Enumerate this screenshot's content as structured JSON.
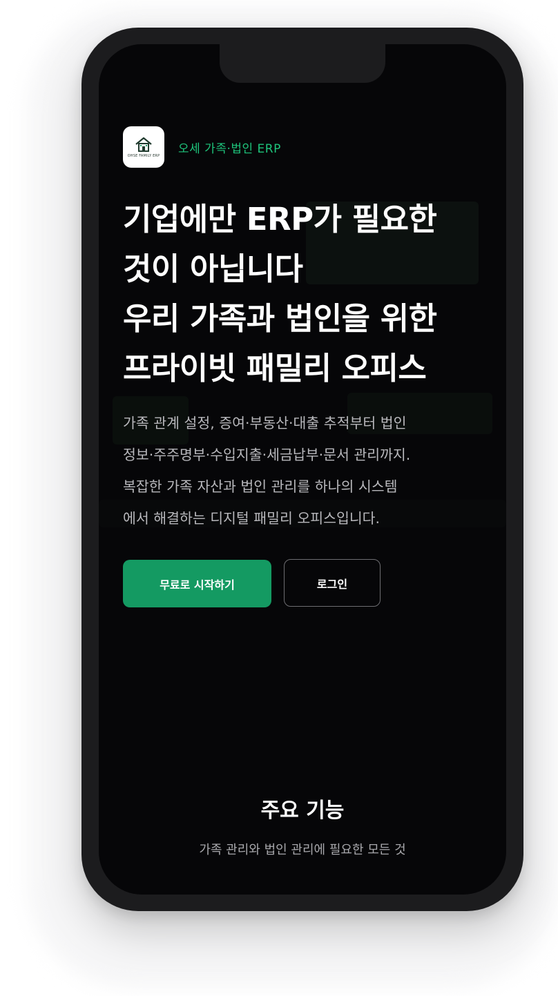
{
  "brand": {
    "name": "오세 가족·법인 ERP",
    "logo_caption": "OHSE FAMILY ERP",
    "accent_color": "#1ec47c"
  },
  "hero": {
    "headline_lines": [
      "기업에만 ERP가 필요한",
      "것이 아닙니다",
      "우리 가족과 법인을 위한",
      "프라이빗 패밀리 오피스"
    ],
    "description_lines": [
      "가족 관계 설정, 증여·부동산·대출 추적부터 법인",
      "정보·주주명부·수입지출·세금납부·문서 관리까지.",
      "복잡한 가족 자산과 법인 관리를 하나의 시스템",
      "에서 해결하는 디지털 패밀리 오피스입니다."
    ]
  },
  "actions": {
    "primary_label": "무료로 시작하기",
    "primary_color": "#149a62",
    "secondary_label": "로그인"
  },
  "features": {
    "title": "주요 기능",
    "subtitle": "가족 관리와 법인 관리에 필요한 모든 것"
  },
  "colors": {
    "screen_background": "#060608",
    "device_frame": "#1c1c1e"
  }
}
